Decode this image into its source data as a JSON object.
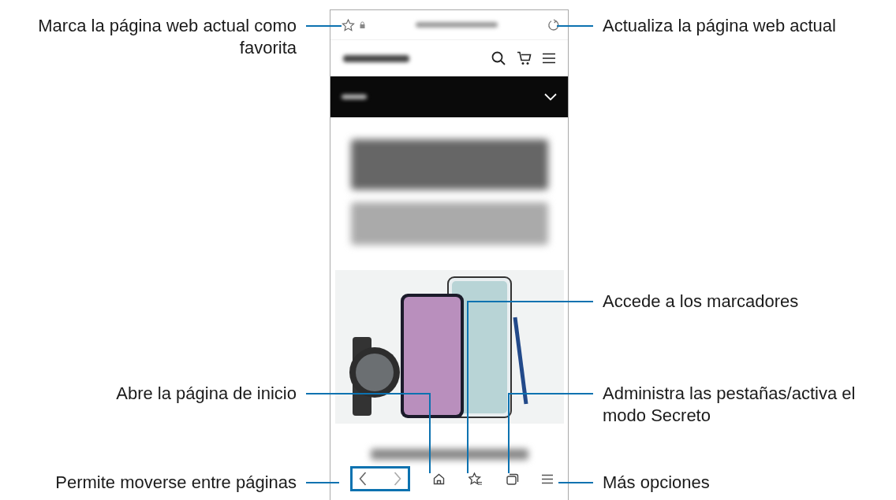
{
  "callouts": [
    {
      "text": "Marca la página web actual como favorita"
    },
    {
      "text": "Actualiza la página web actual"
    },
    {
      "text": "Accede a los marcadores"
    },
    {
      "text": "Abre la página de inicio"
    },
    {
      "text": "Administra las pestañas/activa el modo Secreto"
    },
    {
      "text": "Permite moverse entre páginas"
    },
    {
      "text": "Más opciones"
    }
  ]
}
